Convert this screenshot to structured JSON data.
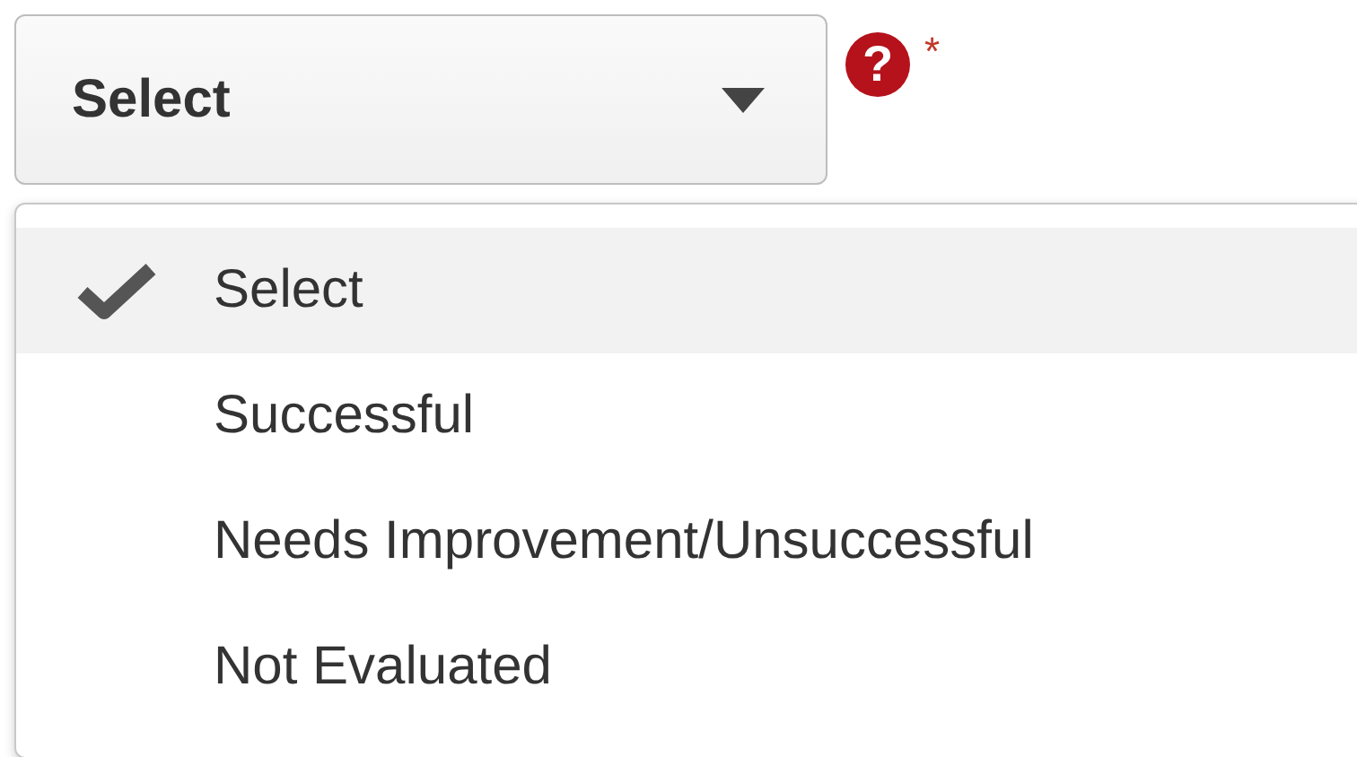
{
  "select": {
    "value": "Select",
    "help": "?",
    "required_mark": "*"
  },
  "options": [
    {
      "label": "Select",
      "selected": true
    },
    {
      "label": "Successful",
      "selected": false
    },
    {
      "label": "Needs Improvement/Unsuccessful",
      "selected": false
    },
    {
      "label": "Not Evaluated",
      "selected": false
    }
  ]
}
